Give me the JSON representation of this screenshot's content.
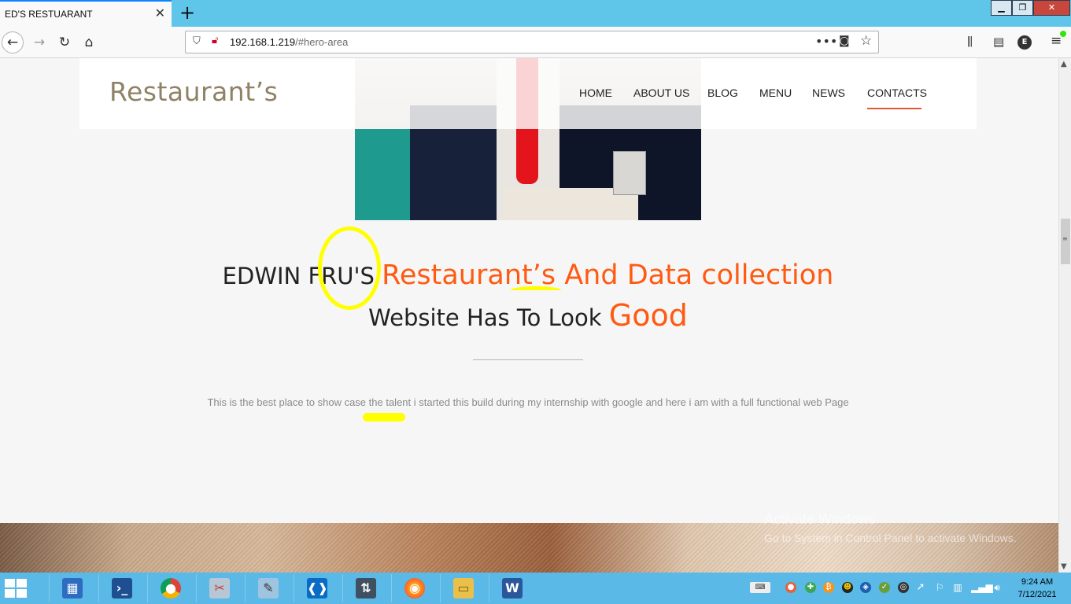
{
  "browser": {
    "tab_title": "ED'S RESTUARANT",
    "url_host": "192.168.1.219",
    "url_path": "/#hero-area",
    "account_initial": "E"
  },
  "site": {
    "logo": "Restaurant’s",
    "nav": [
      "HOME",
      "ABOUT US",
      "BLOG",
      "MENU",
      "NEWS",
      "CONTACTS"
    ],
    "active_nav": "CONTACTS",
    "accent_color": "#e55630"
  },
  "hero": {
    "line1_dark": "EDWIN FRU'S ",
    "line1_orange": "Restaurant’s And Data collection",
    "line2_dark": "Website Has To Look ",
    "line2_orange": "Good",
    "description": "This is the best place to show case the talent i started this build during my internship with google and here i am with a full functional web Page",
    "heading_color": "#222222",
    "highlight_color": "#ff5a12"
  },
  "watermark": {
    "title": "Activate Windows",
    "subtitle": "Go to System in Control Panel to activate Windows."
  },
  "taskbar": {
    "apps": [
      "server-manager-icon",
      "powershell-icon",
      "chrome-icon",
      "snipping-tool-icon",
      "notepad-icon",
      "vscode-icon",
      "network-tool-icon",
      "firefox-icon",
      "file-explorer-icon",
      "word-icon"
    ],
    "time": "9:24 AM",
    "date": "7/12/2021"
  }
}
